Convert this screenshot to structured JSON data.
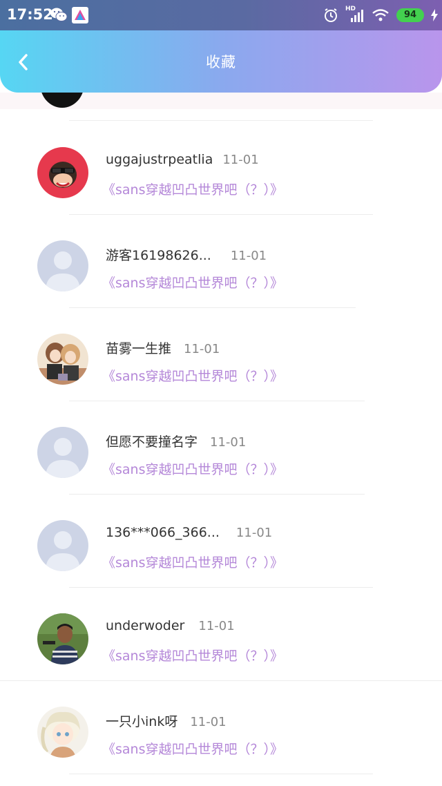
{
  "status_bar": {
    "time": "17:52",
    "battery": "94",
    "network": "HD"
  },
  "header": {
    "title": "收藏"
  },
  "favorites": [
    {
      "user": "uggajustrpeatlia",
      "date": "11-01",
      "post": "《sans穿越凹凸世界吧（？）》",
      "avatar": "monkey-avatar"
    },
    {
      "user": "游客16198626...",
      "date": "11-01",
      "post": "《sans穿越凹凸世界吧（？）》",
      "avatar": "default-avatar"
    },
    {
      "user": "苗雾一生推",
      "date": "11-01",
      "post": "《sans穿越凹凸世界吧（？）》",
      "avatar": "anime-couple-avatar"
    },
    {
      "user": "但愿不要撞名字",
      "date": "11-01",
      "post": "《sans穿越凹凸世界吧（？）》",
      "avatar": "default-avatar"
    },
    {
      "user": "136***066_366...",
      "date": "11-01",
      "post": "《sans穿越凹凸世界吧（？）》",
      "avatar": "default-avatar"
    },
    {
      "user": "underwoder",
      "date": "11-01",
      "post": "《sans穿越凹凸世界吧（？）》",
      "avatar": "boy-photo-avatar"
    },
    {
      "user": "一只小ink呀",
      "date": "11-01",
      "post": "《sans穿越凹凸世界吧（？）》",
      "avatar": "anime-girl-avatar"
    }
  ]
}
